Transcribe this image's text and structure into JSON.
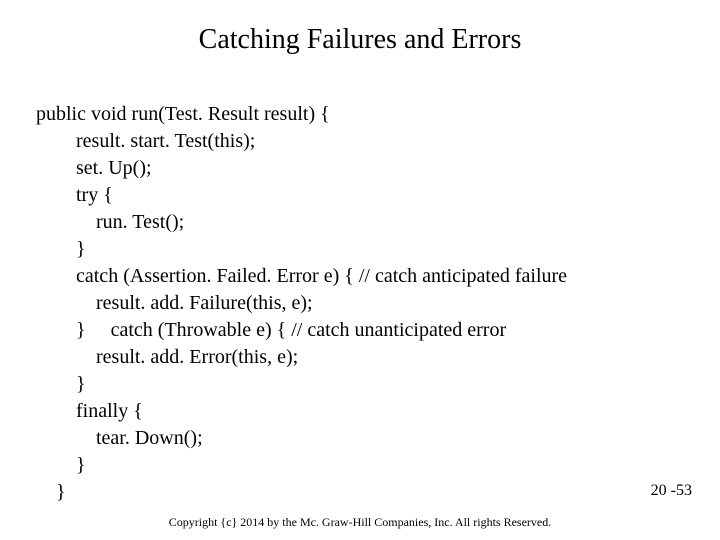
{
  "title": "Catching Failures and Errors",
  "code": {
    "l1": "public void run(Test. Result result) {",
    "l2": "        result. start. Test(this);",
    "l3": "        set. Up();",
    "l4": "        try {",
    "l5": "            run. Test();",
    "l6": "        }",
    "l7": "        catch (Assertion. Failed. Error e) { // catch anticipated failure",
    "l8": "            result. add. Failure(this, e);",
    "l9": "        }     catch (Throwable e) { // catch unanticipated error",
    "l10": "            result. add. Error(this, e);",
    "l11": "        }",
    "l12": "        finally {",
    "l13": "            tear. Down();",
    "l14": "        }",
    "l15": "    }"
  },
  "page_number": "20 -53",
  "copyright": "Copyright {c} 2014 by the Mc. Graw-Hill Companies, Inc. All rights Reserved."
}
